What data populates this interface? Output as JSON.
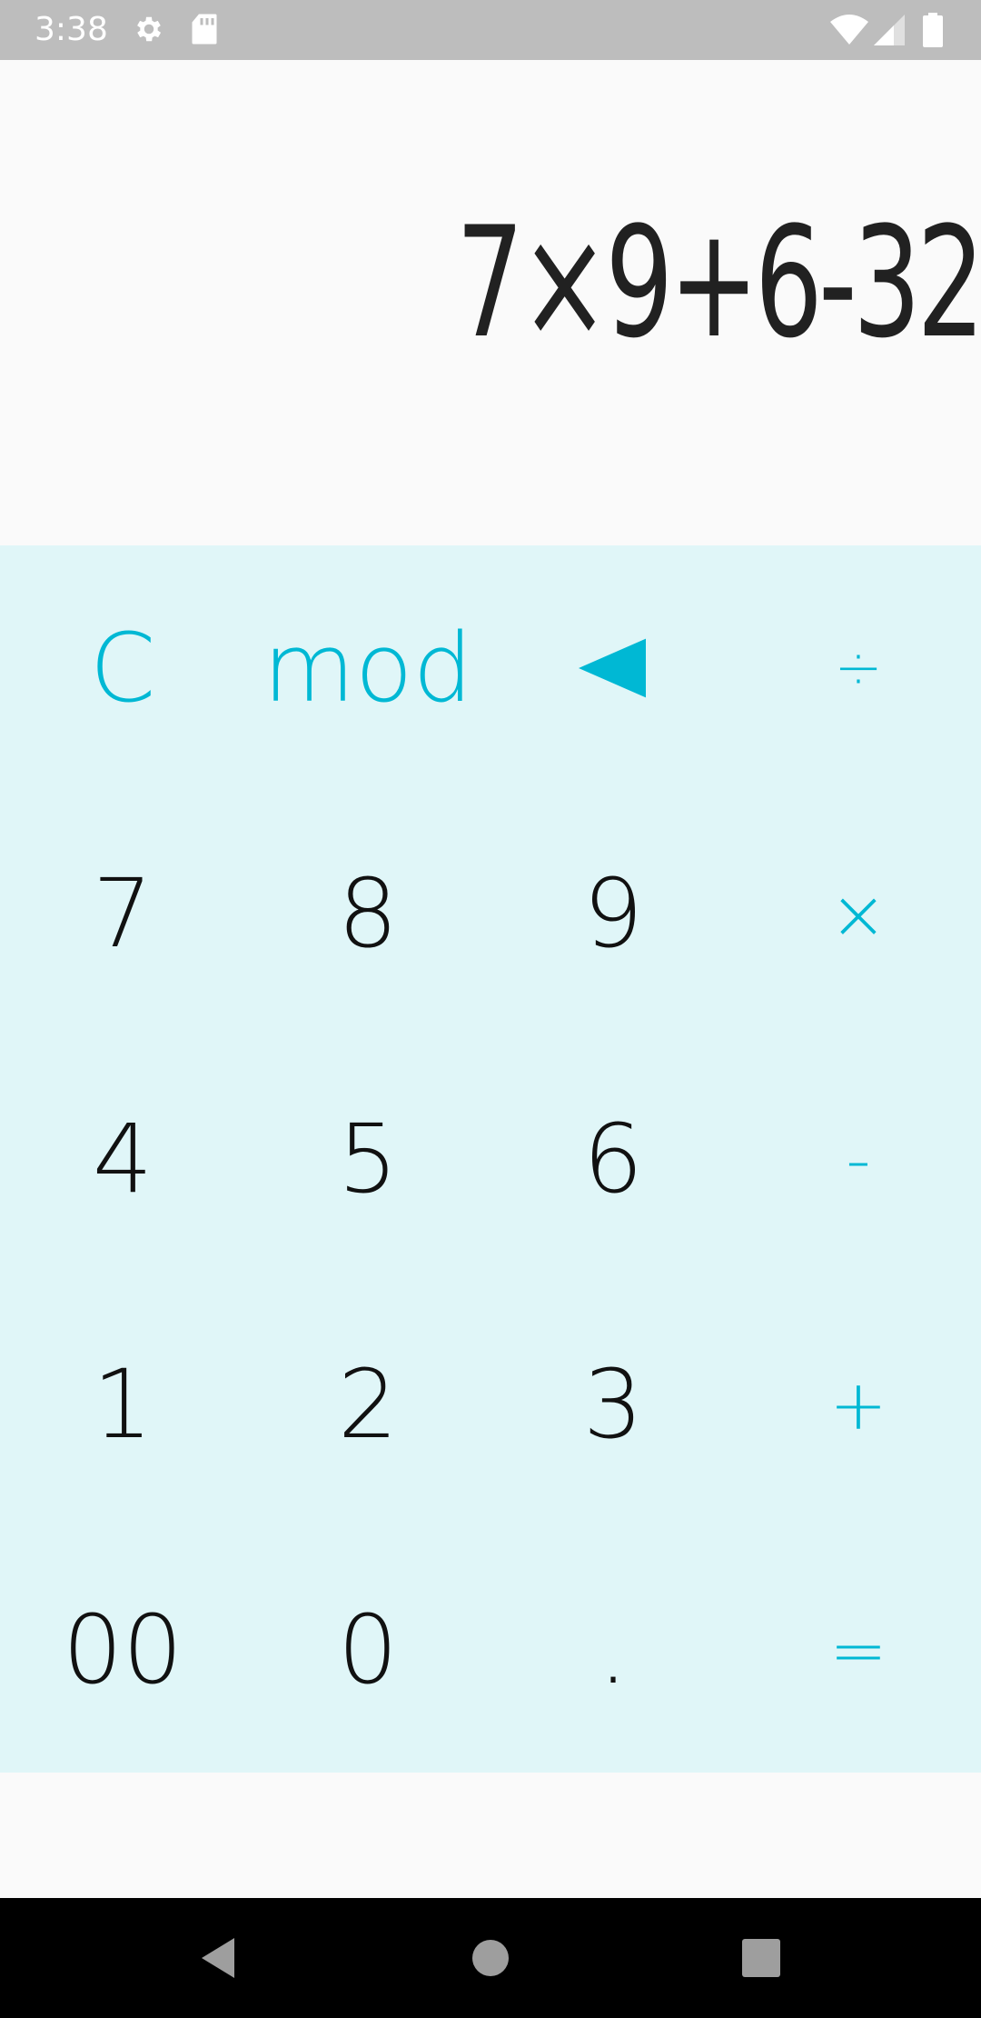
{
  "status_bar": {
    "time": "3:38",
    "icons": [
      "settings-icon",
      "sd-card-icon",
      "wifi-icon",
      "signal-icon",
      "battery-icon"
    ]
  },
  "display": {
    "expression": "7×9+6-32"
  },
  "keypad": {
    "row1": [
      "C",
      "mod",
      "◀",
      "÷"
    ],
    "row2": [
      "7",
      "8",
      "9",
      "×"
    ],
    "row3": [
      "4",
      "5",
      "6",
      "-"
    ],
    "row4": [
      "1",
      "2",
      "3",
      "+"
    ],
    "row5": [
      "00",
      "0",
      ".",
      "="
    ]
  },
  "colors": {
    "accent": "#00b8d4",
    "keypad_bg": "#e0f6f8",
    "digit": "#111111",
    "status_bar": "#bdbdbd"
  },
  "nav_bar": {
    "icons": [
      "back-icon",
      "home-icon",
      "recents-icon"
    ]
  }
}
